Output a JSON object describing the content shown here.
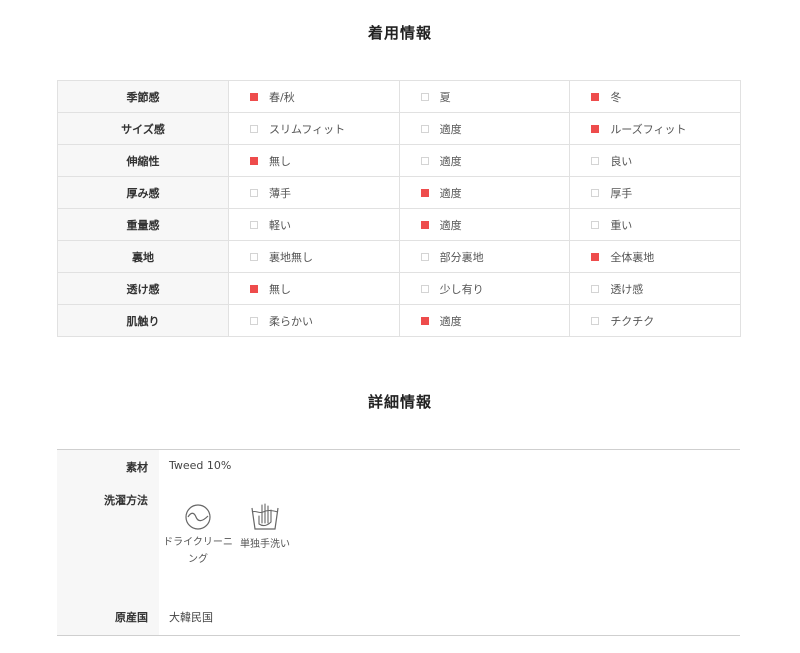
{
  "wearing_info": {
    "title": "着用情報",
    "rows": [
      {
        "label": "季節感",
        "options": [
          {
            "text": "春/秋",
            "selected": true
          },
          {
            "text": "夏",
            "selected": false
          },
          {
            "text": "冬",
            "selected": true
          }
        ]
      },
      {
        "label": "サイズ感",
        "options": [
          {
            "text": "スリムフィット",
            "selected": false
          },
          {
            "text": "適度",
            "selected": false
          },
          {
            "text": "ルーズフィット",
            "selected": true
          }
        ]
      },
      {
        "label": "伸縮性",
        "options": [
          {
            "text": "無し",
            "selected": true
          },
          {
            "text": "適度",
            "selected": false
          },
          {
            "text": "良い",
            "selected": false
          }
        ]
      },
      {
        "label": "厚み感",
        "options": [
          {
            "text": "薄手",
            "selected": false
          },
          {
            "text": "適度",
            "selected": true
          },
          {
            "text": "厚手",
            "selected": false
          }
        ]
      },
      {
        "label": "重量感",
        "options": [
          {
            "text": "軽い",
            "selected": false
          },
          {
            "text": "適度",
            "selected": true
          },
          {
            "text": "重い",
            "selected": false
          }
        ]
      },
      {
        "label": "裏地",
        "options": [
          {
            "text": "裏地無し",
            "selected": false
          },
          {
            "text": "部分裏地",
            "selected": false
          },
          {
            "text": "全体裏地",
            "selected": true
          }
        ]
      },
      {
        "label": "透け感",
        "options": [
          {
            "text": "無し",
            "selected": true
          },
          {
            "text": "少し有り",
            "selected": false
          },
          {
            "text": "透け感",
            "selected": false
          }
        ]
      },
      {
        "label": "肌触り",
        "options": [
          {
            "text": "柔らかい",
            "selected": false
          },
          {
            "text": "適度",
            "selected": true
          },
          {
            "text": "チクチク",
            "selected": false
          }
        ]
      }
    ]
  },
  "detail_info": {
    "title": "詳細情報",
    "material_label": "素材",
    "material_value": "Tweed 10%",
    "wash_label": "洗濯方法",
    "care_items": [
      {
        "icon": "dry-clean-icon",
        "label_line1": "ドライクリーニ",
        "label_line2": "ング"
      },
      {
        "icon": "hand-wash-icon",
        "label_line1": "単独手洗い",
        "label_line2": ""
      }
    ],
    "origin_label": "原産国",
    "origin_value": "大韓民国"
  },
  "colors": {
    "selected": "#ee4c4c",
    "unselected_border": "#d4d4d4",
    "label_bg": "#f7f7f7"
  }
}
